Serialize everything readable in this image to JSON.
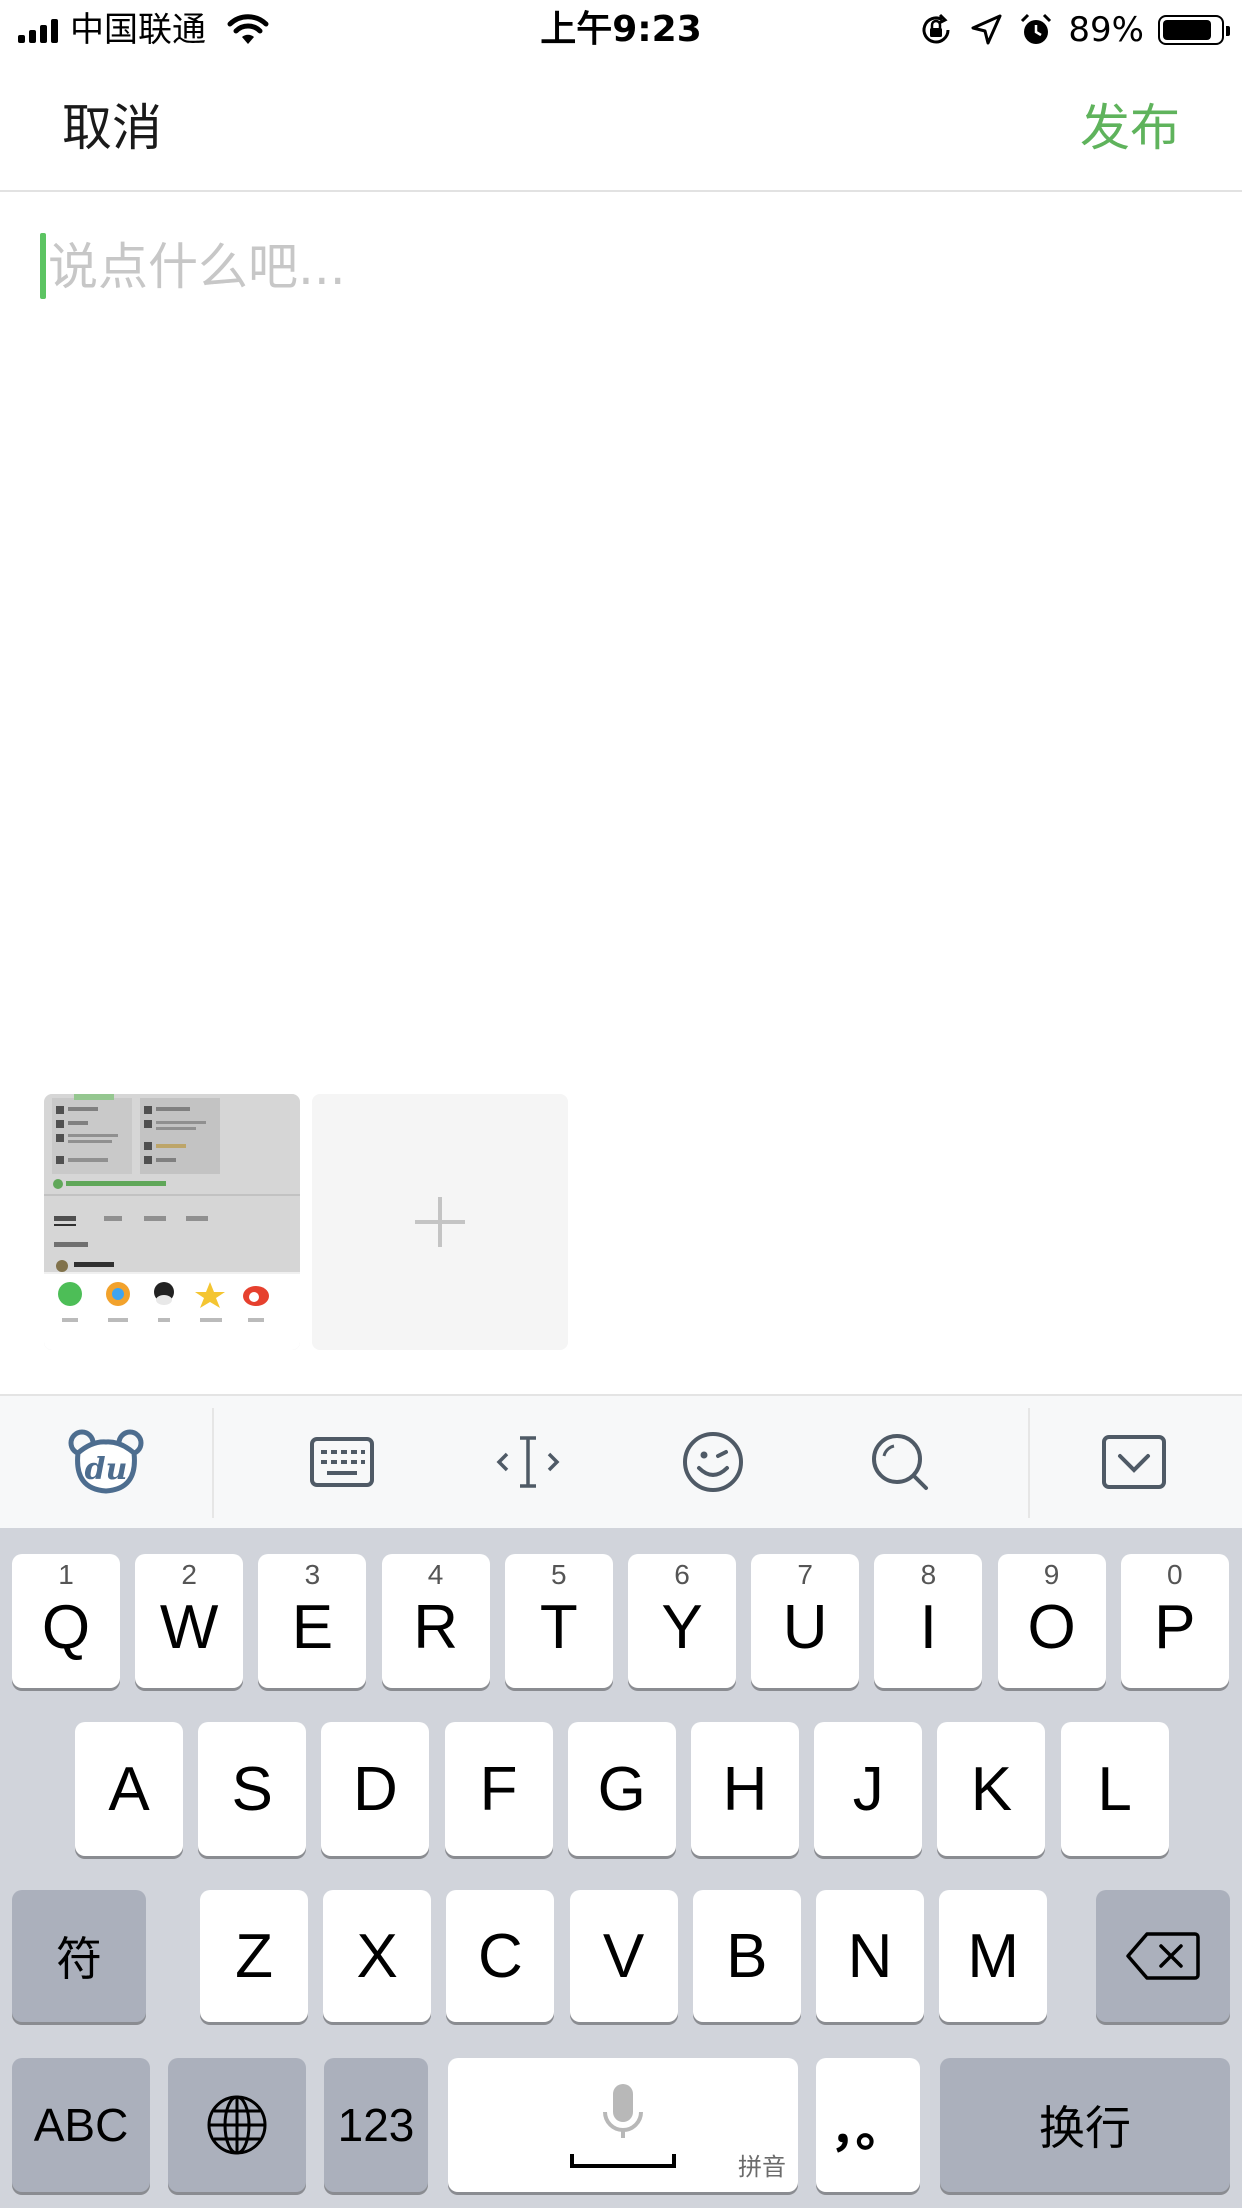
{
  "status_bar": {
    "carrier": "中国联通",
    "time": "上午9:23",
    "battery_percent": "89%",
    "battery_level": 0.89,
    "icons": [
      "signal-icon",
      "wifi-icon",
      "orientation-lock-icon",
      "location-icon",
      "alarm-icon",
      "battery-icon"
    ]
  },
  "nav": {
    "cancel_label": "取消",
    "publish_label": "发布",
    "accent_color": "#5fb35c"
  },
  "compose": {
    "placeholder": "说点什么吧..."
  },
  "attachments": {
    "thumbnail_icon": "screenshot-thumbnail",
    "add_icon": "plus-icon"
  },
  "toolbar": {
    "buttons": [
      "du-bear-logo-icon",
      "keyboard-icon",
      "cursor-move-icon",
      "emoji-icon",
      "search-icon",
      "collapse-keyboard-icon"
    ]
  },
  "keyboard": {
    "row1": [
      {
        "num": "1",
        "key": "Q"
      },
      {
        "num": "2",
        "key": "W"
      },
      {
        "num": "3",
        "key": "E"
      },
      {
        "num": "4",
        "key": "R"
      },
      {
        "num": "5",
        "key": "T"
      },
      {
        "num": "6",
        "key": "Y"
      },
      {
        "num": "7",
        "key": "U"
      },
      {
        "num": "8",
        "key": "I"
      },
      {
        "num": "9",
        "key": "O"
      },
      {
        "num": "0",
        "key": "P"
      }
    ],
    "row2": [
      "A",
      "S",
      "D",
      "F",
      "G",
      "H",
      "J",
      "K",
      "L"
    ],
    "row3": [
      "Z",
      "X",
      "C",
      "V",
      "B",
      "N",
      "M"
    ],
    "symbol_key": "符",
    "abc_key": "ABC",
    "num_key": "123",
    "space_sub": "拼音",
    "punct_key": "，。",
    "return_key": "换行"
  }
}
